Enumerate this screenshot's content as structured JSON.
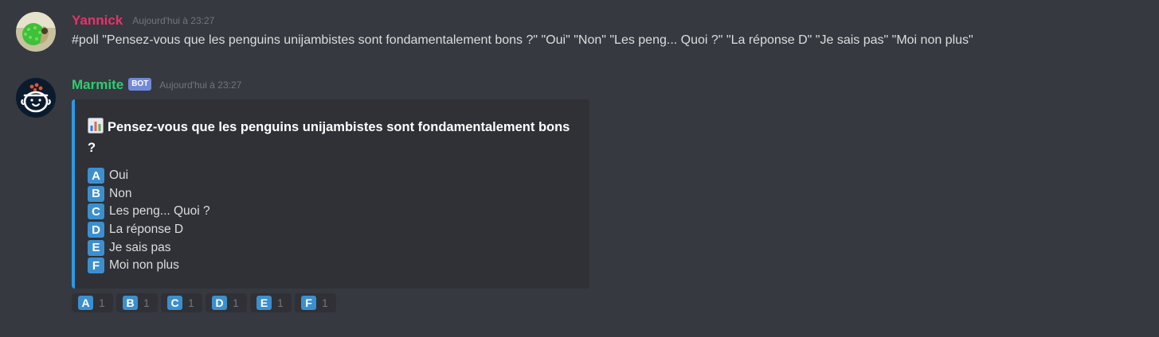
{
  "messages": [
    {
      "username": "Yannick",
      "username_color": "#e5336b",
      "timestamp": "Aujourd'hui à 23:27",
      "content": "#poll \"Pensez-vous que les penguins unijambistes sont fondamentalement bons ?\" \"Oui\" \"Non\" \"Les peng... Quoi ?\" \"La réponse D\" \"Je sais pas\" \"Moi non plus\""
    },
    {
      "username": "Marmite",
      "username_color": "#2ecc71",
      "bot_tag": "BOT",
      "timestamp": "Aujourd'hui à 23:27",
      "embed": {
        "accent_color": "#2b9ae9",
        "icon": "bar-chart-icon",
        "title": "Pensez-vous que les penguins unijambistes sont fondamentalement bons ?",
        "options": [
          {
            "letter": "A",
            "label": "Oui"
          },
          {
            "letter": "B",
            "label": "Non"
          },
          {
            "letter": "C",
            "label": "Les peng... Quoi ?"
          },
          {
            "letter": "D",
            "label": "La réponse D"
          },
          {
            "letter": "E",
            "label": "Je sais pas"
          },
          {
            "letter": "F",
            "label": "Moi non plus"
          }
        ]
      },
      "reactions": [
        {
          "letter": "A",
          "count": "1"
        },
        {
          "letter": "B",
          "count": "1"
        },
        {
          "letter": "C",
          "count": "1"
        },
        {
          "letter": "D",
          "count": "1"
        },
        {
          "letter": "E",
          "count": "1"
        },
        {
          "letter": "F",
          "count": "1"
        }
      ]
    }
  ]
}
